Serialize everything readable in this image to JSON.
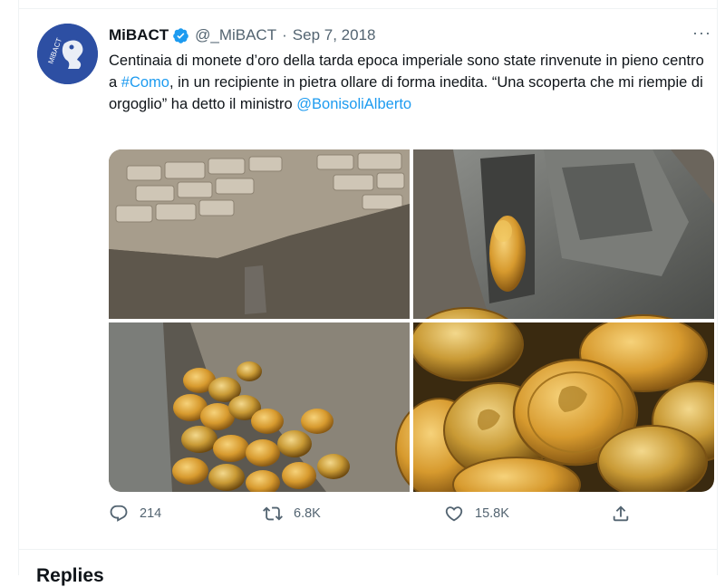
{
  "tweet": {
    "author_name": "MiBACT",
    "handle": "@_MiBACT",
    "separator": "·",
    "date": "Sep 7, 2018",
    "more_label": "···",
    "avatar_label": "MiBACT",
    "text_part1": "Centinaia di monete d’oro della tarda epoca imperiale sono state rinvenute in pieno centro a ",
    "hashtag": "#Como",
    "text_part2": ", in un recipiente in pietra ollare di forma inedita. “Una scoperta che mi riempie di orgoglio” ha detto il ministro ",
    "mention": "@BonisoliAlberto",
    "media": [
      {
        "icon": "excavation-photo"
      },
      {
        "icon": "stone-vessel-photo"
      },
      {
        "icon": "coins-in-vessel-photo"
      },
      {
        "icon": "gold-coins-closeup-photo"
      }
    ],
    "actions": {
      "reply_count": "214",
      "retweet_count": "6.8K",
      "like_count": "15.8K"
    }
  },
  "replies_heading": "Replies",
  "colors": {
    "link": "#1d9bf0",
    "verified": "#1d9bf0",
    "avatar_bg": "#2d4fa3",
    "secondary_text": "#536471"
  }
}
